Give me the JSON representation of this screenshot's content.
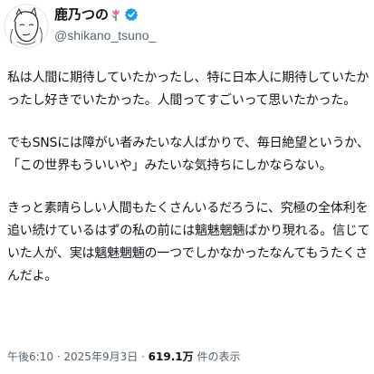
{
  "profile": {
    "display_name": "鹿乃つの",
    "handle": "@shikano_tsuno_",
    "emoji_icon": "tulip-icon",
    "verified_color": "#1d9bf0"
  },
  "tweet": {
    "paragraphs": [
      "私は人間に期待していたかったし、特に日本人に期待していたかったし好きでいたかった。人間ってすごいって思いたかった。",
      "でもSNSには障がい者みたいな人ばかりで、毎日絶望というか、「この世界もういいや」みたいな気持ちにしかならない。",
      "きっと素晴らしい人間もたくさんいるだろうに、究極の全体利を追い続けているはずの私の前には魑魅魍魎ばかり現れる。信じていた人が、実は魑魅魍魎の一つでしかなかったなんてもうたくさんだよ。"
    ]
  },
  "meta": {
    "time": "午後6:10",
    "separator": " · ",
    "date": "2025年9月3日",
    "views_count": "619.1万",
    "views_label": " 件の表示"
  }
}
